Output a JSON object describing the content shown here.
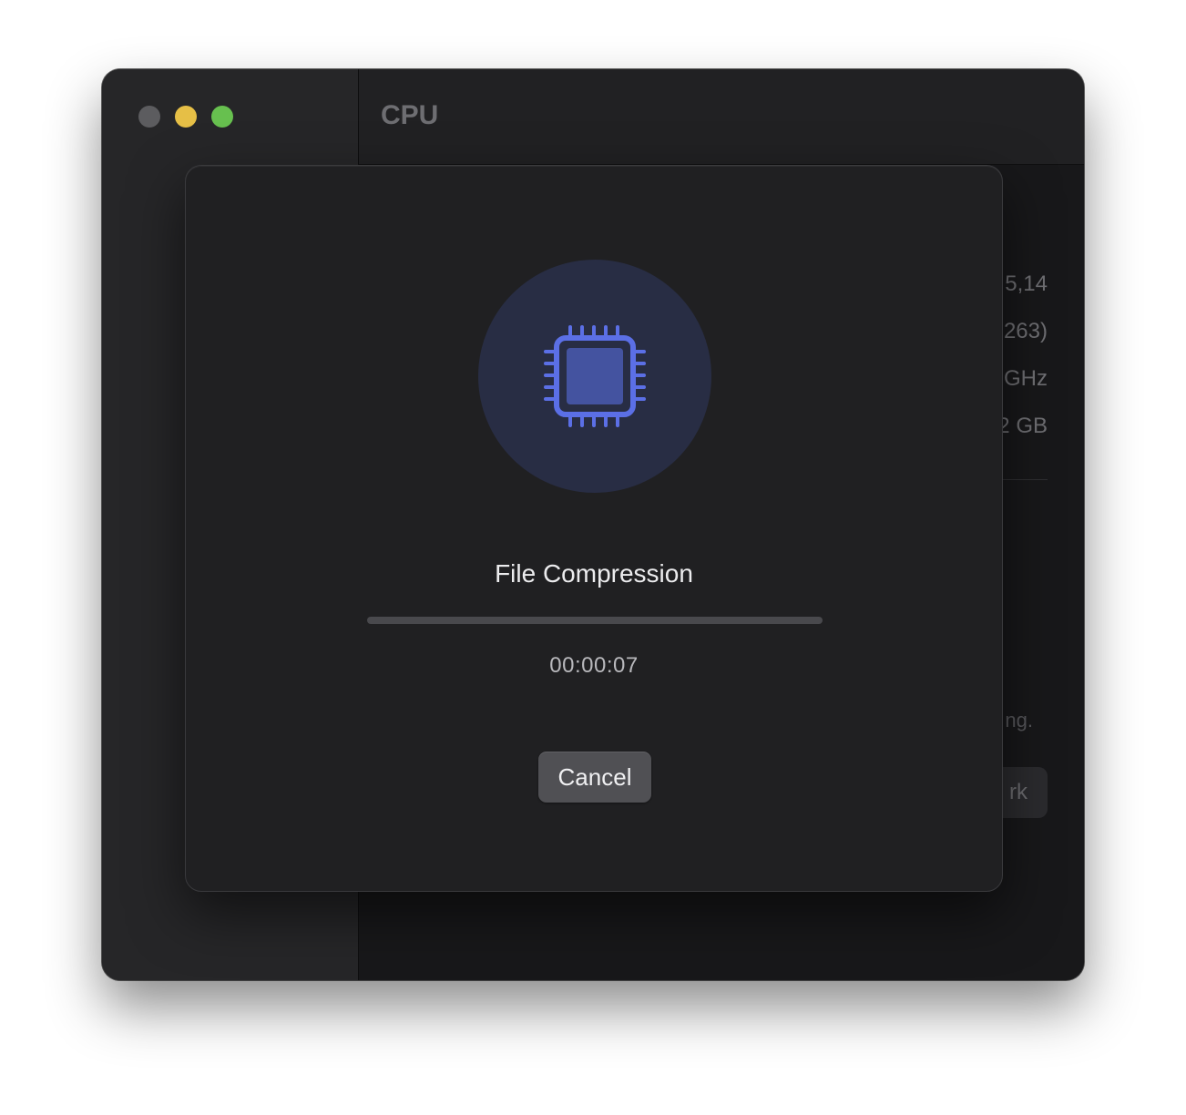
{
  "window": {
    "toolbar_title": "CPU",
    "traffic_lights": {
      "close": "close-button",
      "minimize": "minimize-button",
      "zoom": "zoom-button"
    }
  },
  "background_content": {
    "info_values": [
      "5,14",
      "263)",
      "GHz",
      "2 GB"
    ],
    "note_text": "ng.",
    "button_label": "rk"
  },
  "dialog": {
    "icon": "cpu-chip-icon",
    "title": "File Compression",
    "progress_fraction": 0,
    "elapsed_time": "00:00:07",
    "cancel_label": "Cancel"
  },
  "colors": {
    "accent": "#5b6fe6",
    "icon_circle": "#282d44",
    "dialog_bg": "#202022"
  }
}
